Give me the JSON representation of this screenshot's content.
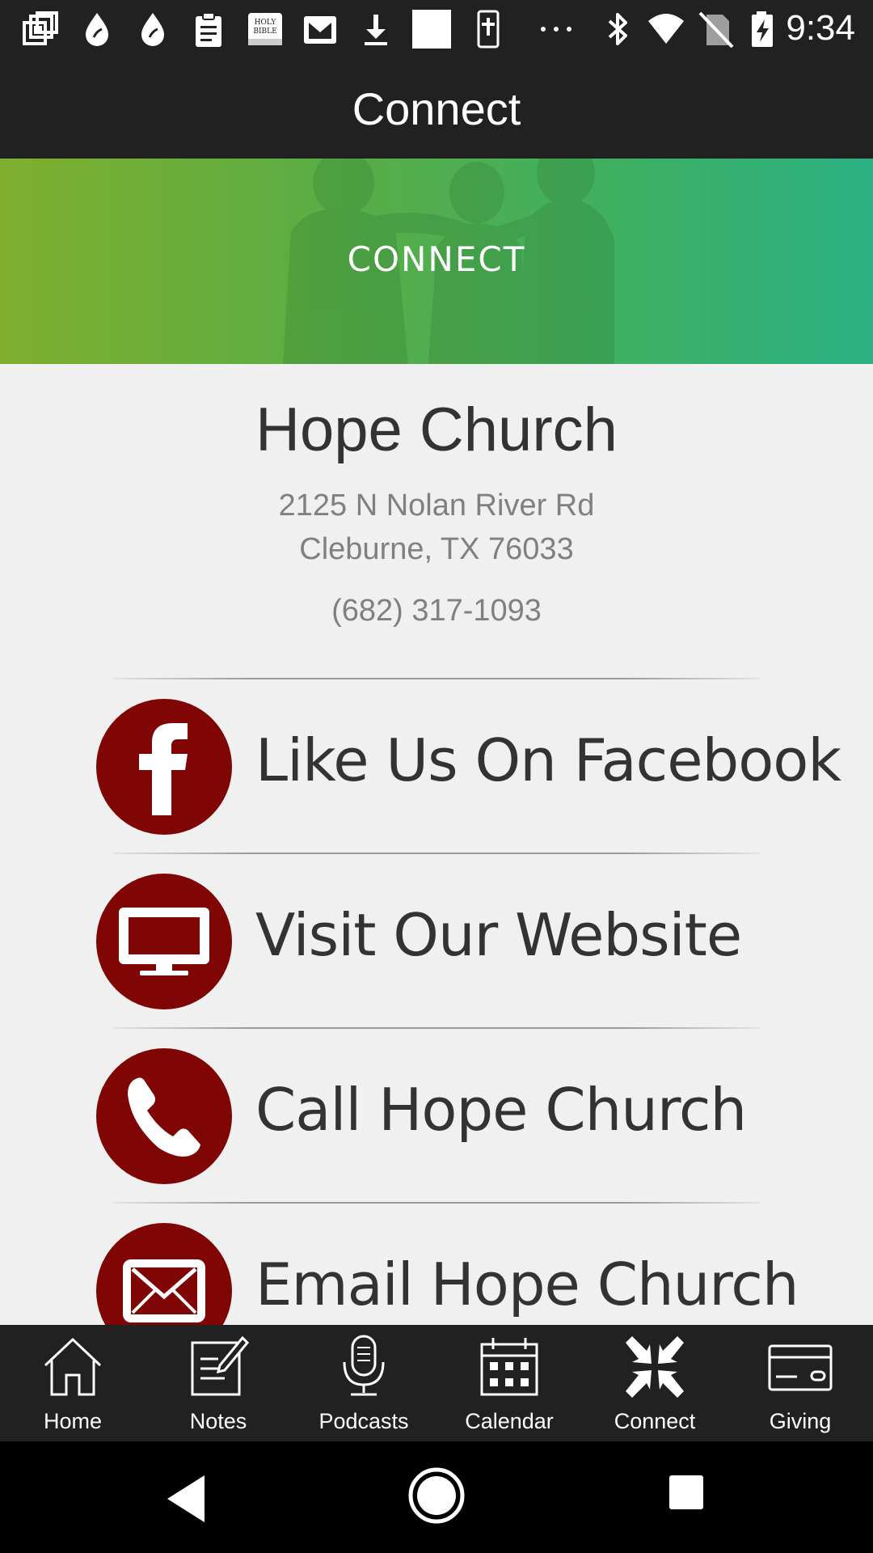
{
  "status_bar": {
    "time": "9:34",
    "icons": [
      "notification-stack-icon",
      "drop-icon",
      "drop-icon",
      "clipboard-icon",
      "holy-bible-icon",
      "mail-icon",
      "download-icon",
      "blank-square-icon",
      "bible-cross-icon",
      "more-dots-icon",
      "bluetooth-icon",
      "wifi-icon",
      "no-sim-icon",
      "battery-charging-icon"
    ],
    "bible_label_line1": "HOLY",
    "bible_label_line2": "BIBLE"
  },
  "app_bar": {
    "title": "Connect"
  },
  "banner": {
    "text": "CONNECT"
  },
  "church": {
    "name": "Hope Church",
    "address_line1": "2125 N Nolan River Rd",
    "address_line2": "Cleburne, TX 76033",
    "phone": "(682) 317-1093"
  },
  "actions": [
    {
      "label": "Like Us On Facebook",
      "icon": "facebook-icon"
    },
    {
      "label": "Visit Our Website",
      "icon": "monitor-icon"
    },
    {
      "label": "Call Hope Church",
      "icon": "phone-icon"
    },
    {
      "label": "Email Hope Church",
      "icon": "envelope-icon"
    }
  ],
  "bottom_nav": [
    {
      "label": "Home",
      "icon": "home-icon"
    },
    {
      "label": "Notes",
      "icon": "notes-icon"
    },
    {
      "label": "Podcasts",
      "icon": "microphone-icon"
    },
    {
      "label": "Calendar",
      "icon": "calendar-icon"
    },
    {
      "label": "Connect",
      "icon": "connect-arrows-icon",
      "active": true
    },
    {
      "label": "Giving",
      "icon": "credit-card-icon"
    }
  ],
  "system_nav": [
    "back-icon",
    "home-circle-icon",
    "recents-icon"
  ],
  "colors": {
    "bar": "#212121",
    "accent_red": "#800505",
    "banner_left": "#7fae2e",
    "banner_right": "#2bb083"
  }
}
